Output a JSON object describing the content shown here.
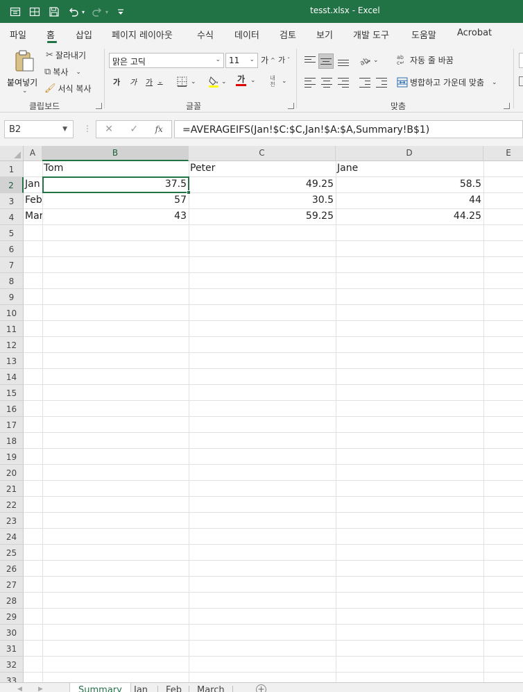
{
  "window": {
    "title": "tesst.xlsx  -  Excel"
  },
  "qat": [
    "autosave-icon",
    "form-icon",
    "save-icon",
    "undo-icon",
    "redo-icon",
    "customize-icon"
  ],
  "tabs": [
    {
      "label": "파일",
      "active": false
    },
    {
      "label": "홈",
      "active": true
    },
    {
      "label": "삽입",
      "active": false
    },
    {
      "label": "페이지 레이아웃",
      "active": false
    },
    {
      "label": "수식",
      "active": false
    },
    {
      "label": "데이터",
      "active": false
    },
    {
      "label": "검토",
      "active": false
    },
    {
      "label": "보기",
      "active": false
    },
    {
      "label": "개발 도구",
      "active": false
    },
    {
      "label": "도움말",
      "active": false
    },
    {
      "label": "Acrobat",
      "active": false
    }
  ],
  "ribbon": {
    "clipboard": {
      "paste": "붙여넣기",
      "cut": "잘라내기",
      "copy": "복사",
      "format_painter": "서식 복사",
      "label": "클립보드"
    },
    "font": {
      "name": "맑은 고딕",
      "size": "11",
      "grow": "가",
      "shrink": "가",
      "bold": "가",
      "italic": "가",
      "underline": "가",
      "font_color": "가",
      "phonetic": "내천",
      "label": "글꼴"
    },
    "alignment": {
      "wrap": "자동 줄 바꿈",
      "merge": "병합하고 가운데 맞춤",
      "label": "맞춤"
    }
  },
  "formula_bar": {
    "name_box": "B2",
    "fx": "fx",
    "formula": "=AVERAGEIFS(Jan!$C:$C,Jan!$A:$A,Summary!B$1)"
  },
  "columns": [
    "A",
    "B",
    "C",
    "D",
    "E"
  ],
  "selected_column": "B",
  "selected_row": 2,
  "row_numbers": [
    "1",
    "2",
    "3",
    "4",
    "5",
    "6",
    "7",
    "8",
    "9",
    "10",
    "11",
    "12",
    "13",
    "14",
    "15",
    "16",
    "17",
    "18",
    "19",
    "20",
    "21",
    "22",
    "23",
    "24",
    "25",
    "26",
    "27",
    "28",
    "29",
    "30",
    "31",
    "32",
    "33"
  ],
  "cells": {
    "header_row": [
      "",
      "Tom",
      "Peter",
      "Jane"
    ],
    "rows": [
      {
        "label": "Jan",
        "values": [
          "37.5",
          "49.25",
          "58.5"
        ]
      },
      {
        "label": "Feb",
        "values": [
          "57",
          "30.5",
          "44"
        ]
      },
      {
        "label": "Mar",
        "values": [
          "43",
          "59.25",
          "44.25"
        ]
      }
    ]
  },
  "sheets": [
    {
      "label": "Summary",
      "active": true
    },
    {
      "label": "Jan",
      "active": false
    },
    {
      "label": "Feb",
      "active": false
    },
    {
      "label": "March",
      "active": false
    }
  ],
  "colors": {
    "accent": "#217346"
  }
}
